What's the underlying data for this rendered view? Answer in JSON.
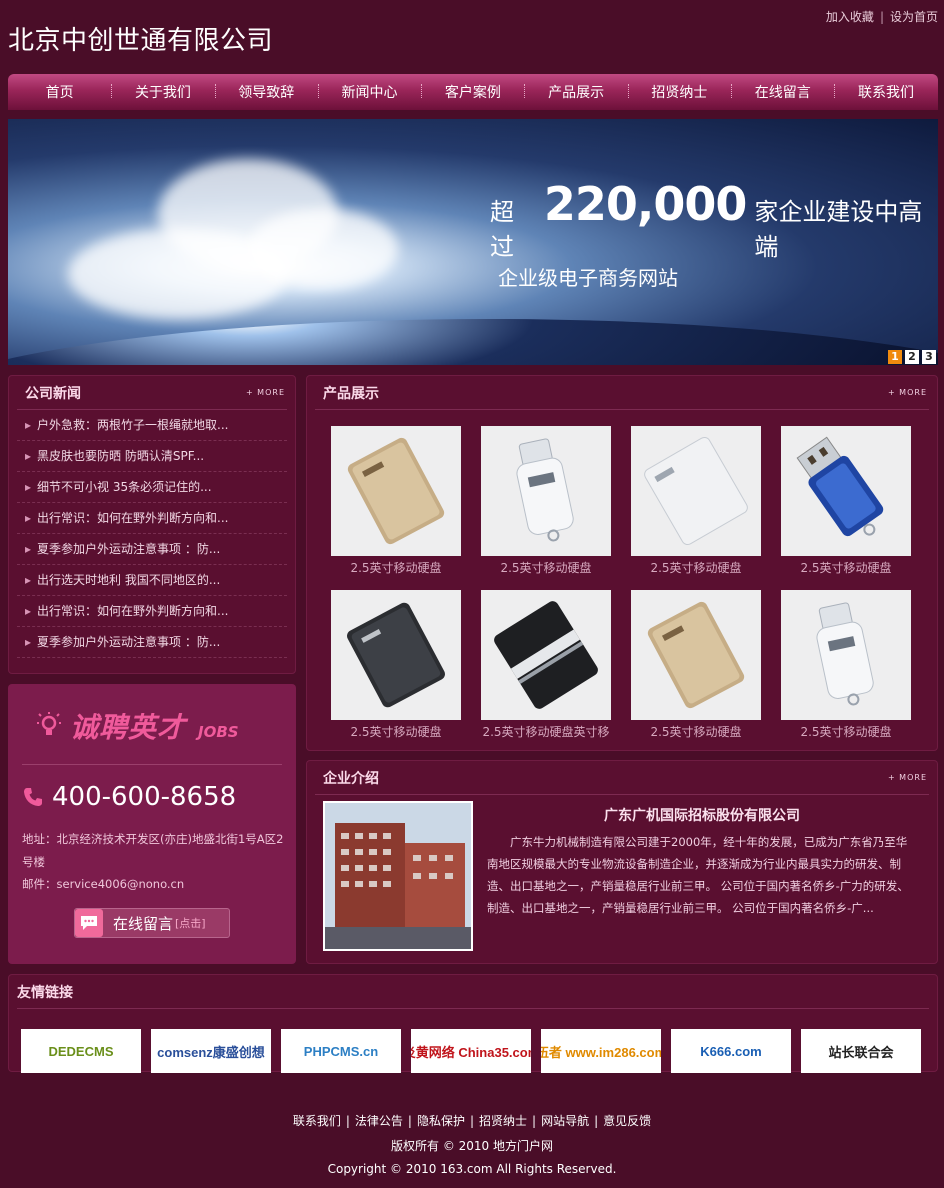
{
  "header": {
    "logo": "北京中创世通有限公司",
    "top_links": [
      "加入收藏",
      "设为首页"
    ],
    "top_sep": "|"
  },
  "nav": {
    "items": [
      "首页",
      "关于我们",
      "领导致辞",
      "新闻中心",
      "客户案例",
      "产品展示",
      "招贤纳士",
      "在线留言",
      "联系我们"
    ]
  },
  "banner": {
    "prefix": "超过",
    "number": "220,000",
    "suffix": "家企业建设中高端",
    "line2": "企业级电子商务网站",
    "pages": [
      "1",
      "2",
      "3"
    ],
    "active_page": "1"
  },
  "news": {
    "title": "公司新闻",
    "more": "+ MORE",
    "items": [
      "户外急救：两根竹子一根绳就地取...",
      "黑皮肤也要防晒 防晒认清SPF...",
      "细节不可小视 35条必须记住的...",
      "出行常识：如何在野外判断方向和...",
      "夏季参加户外运动注意事项 ：防...",
      "出行选天时地利 我国不同地区的...",
      "出行常识：如何在野外判断方向和...",
      "夏季参加户外运动注意事项 ：防..."
    ]
  },
  "jobs": {
    "title": "诚聘英才",
    "subtitle": "JOBS",
    "phone": "400-600-8658",
    "address_label": "地址：",
    "address": "北京经济技术开发区(亦庄)地盛北街1号A区2号楼",
    "mail_label": "邮件：",
    "mail": "service4006@nono.cn",
    "message_label": "在线留言",
    "message_hint": "[点击]"
  },
  "products": {
    "title": "产品展示",
    "more": "+ MORE",
    "items": [
      {
        "caption": "2.5英寸移动硬盘",
        "kind": "gold-drive"
      },
      {
        "caption": "2.5英寸移动硬盘",
        "kind": "white-usb"
      },
      {
        "caption": "2.5英寸移动硬盘",
        "kind": "white-drive"
      },
      {
        "caption": "2.5英寸移动硬盘",
        "kind": "blue-usb"
      },
      {
        "caption": "2.5英寸移动硬盘",
        "kind": "black-drive"
      },
      {
        "caption": "2.5英寸移动硬盘英寸移",
        "kind": "black-stripe-drive"
      },
      {
        "caption": "2.5英寸移动硬盘",
        "kind": "gold-drive"
      },
      {
        "caption": "2.5英寸移动硬盘",
        "kind": "white-usb"
      }
    ]
  },
  "intro": {
    "title": "企业介绍",
    "more": "+ MORE",
    "company": "广东广机国际招标股份有限公司",
    "text": "广东牛力机械制造有限公司建于2000年，经十年的发展，已成为广东省乃至华南地区规模最大的专业物流设备制造企业，并逐渐成为行业内最具实力的研发、制造、出口基地之一，产销量稳居行业前三甲。 公司位于国内著名侨乡-广力的研发、制造、出口基地之一，产销量稳居行业前三甲。 公司位于国内著名侨乡-广..."
  },
  "links": {
    "title": "友情链接",
    "logos": [
      {
        "label": "DEDECMS",
        "color": "#6a8f1a"
      },
      {
        "label": "comsenz康盛创想",
        "color": "#2a4f9a"
      },
      {
        "label": "PHPCMS.cn",
        "color": "#2c7fc4"
      },
      {
        "label": "炎黄网络 China35.com",
        "color": "#c0141b"
      },
      {
        "label": "伍者 www.im286.com",
        "color": "#e08a00"
      },
      {
        "label": "K666.com",
        "color": "#1a5fb4"
      },
      {
        "label": "站长联合会",
        "color": "#222222"
      }
    ]
  },
  "footer": {
    "links": [
      "联系我们",
      "法律公告",
      "隐私保护",
      "招贤纳士",
      "网站导航",
      "意见反馈"
    ],
    "sep": "|",
    "copyright_cn": "版权所有 © 2010 地方门户网",
    "copyright_en": "Copyright © 2010 163.com All Rights Reserved."
  },
  "colors": {
    "background": "#4a0d28",
    "nav": "#9a2559",
    "jobs_accent": "#f05a9b",
    "pager_active": "#f08a0e"
  }
}
